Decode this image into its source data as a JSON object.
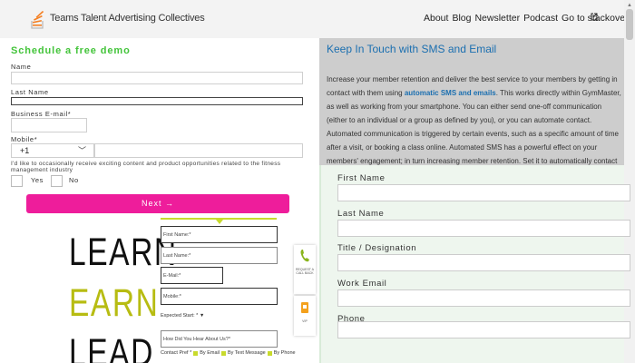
{
  "header": {
    "brand": "Teams Talent Advertising Collectives",
    "nav": [
      "About",
      "Blog",
      "Newsletter",
      "Podcast",
      "Go to stackoverflow.com"
    ]
  },
  "demo_form": {
    "title": "Schedule a free demo",
    "name_label": "Name",
    "last_name_label": "Last Name",
    "email_label": "Business E-mail*",
    "mobile_label": "Mobile*",
    "phone_code": "+1",
    "consent_text": "I'd like to occasionally receive exciting content and product opportunities related to the fitness management industry",
    "yes_label": "Yes",
    "no_label": "No",
    "next_label": "Next  →"
  },
  "hero_words": [
    "LEARN",
    "EARN",
    "LEAD"
  ],
  "small_form": {
    "first_name": "First Name:*",
    "last_name": "Last Name:*",
    "email": "E-Mail:*",
    "mobile": "Mobile:*",
    "expected_start": "Expected Start: *",
    "heard_about": "How Did You Hear About Us?*",
    "contact_pref": "Contact Pref *",
    "contact_options": [
      "By Email",
      "By Text Message",
      "By Phone"
    ]
  },
  "widgets": {
    "call_text": "REQUEST A CALL BACK",
    "vip_text": "VIP"
  },
  "sms_panel": {
    "title": "Keep In Touch with SMS and Email",
    "body_before": "Increase your member retention and deliver the best service to your members by getting in contact with them using ",
    "body_link": "automatic SMS and emails",
    "body_after": ". This works directly within GymMaster, as well as working from your smartphone. You can either send one-off communication (either to an individual or a group as defined by you), or you can automate contact. Automated communication is triggered by certain events, such as a specific amount of time after a visit, or booking a class online. Automated SMS has a powerful effect on your members' engagement; in turn increasing member retention. Set it to automatically contact members identified to be at risk of cancelling, or to those who have not been keeping up to date with their payments."
  },
  "right_form": {
    "first_name": "First Name",
    "last_name": "Last Name",
    "title": "Title / Designation",
    "work_email": "Work Email",
    "phone": "Phone"
  },
  "colors": {
    "accent_green": "#43c43a",
    "cta_pink": "#ee1d9b",
    "earn_olive": "#b7bc12",
    "link_blue": "#1b6fb0"
  }
}
